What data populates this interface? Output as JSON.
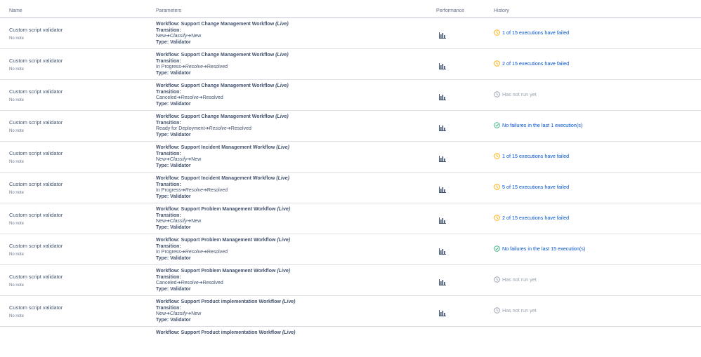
{
  "header": {
    "name": "Name",
    "parameters": "Parameters",
    "performance": "Performance",
    "history": "History"
  },
  "colors": {
    "warn": "#ffab00",
    "success": "#36b37e",
    "muted": "#97a0af",
    "link": "#0052cc"
  },
  "labels": {
    "transition": "Transition:",
    "live": "(Live)"
  },
  "rows": [
    {
      "name": "Custom script validator",
      "note": "No note",
      "workflow": "Workflow: Support Change Management Workflow",
      "from": "New",
      "action": "Classify",
      "to": "New",
      "type": "Type: Validator",
      "history": "1 of 15 executions have failed",
      "status": "warn"
    },
    {
      "name": "Custom script validator",
      "note": "No note",
      "workflow": "Workflow: Support Change Management Workflow",
      "from": "In Progress",
      "action": "Resolve",
      "to": "Resolved",
      "type": "Type: Validator",
      "history": "2 of 15 executions have failed",
      "status": "warn"
    },
    {
      "name": "Custom script validator",
      "note": "No note",
      "workflow": "Workflow: Support Change Management Workflow",
      "from": "Canceled",
      "action": "Resolve",
      "to": "Resolved",
      "type": "Type: Validator",
      "history": "Has not run yet",
      "status": "none"
    },
    {
      "name": "Custom script validator",
      "note": "No note",
      "workflow": "Workflow: Support Change Management Workflow",
      "from": "Ready for Deployment",
      "action": "Resolve",
      "to": "Resolved",
      "type": "Type: Validator",
      "history": "No failures in the last 1 execution(s)",
      "status": "ok"
    },
    {
      "name": "Custom script validator",
      "note": "No note",
      "workflow": "Workflow: Support Incident Management Workflow",
      "from": "New",
      "action": "Classify",
      "to": "New",
      "type": "Type: Validator",
      "history": "1 of 15 executions have failed",
      "status": "warn"
    },
    {
      "name": "Custom script validator",
      "note": "No note",
      "workflow": "Workflow: Support Incident Management Workflow",
      "from": "In Progress",
      "action": "Resolve",
      "to": "Resolved",
      "type": "Type: Validator",
      "history": "5 of 15 executions have failed",
      "status": "warn"
    },
    {
      "name": "Custom script validator",
      "note": "No note",
      "workflow": "Workflow: Support Problem Management Workflow",
      "from": "New",
      "action": "Classify",
      "to": "New",
      "type": "Type: Validator",
      "history": "2 of 15 executions have failed",
      "status": "warn"
    },
    {
      "name": "Custom script validator",
      "note": "No note",
      "workflow": "Workflow: Support Problem Management Workflow",
      "from": "In Progress",
      "action": "Resolve",
      "to": "Resolved",
      "type": "Type: Validator",
      "history": "No failures in the last 15 execution(s)",
      "status": "ok"
    },
    {
      "name": "Custom script validator",
      "note": "No note",
      "workflow": "Workflow: Support Problem Management Workflow",
      "from": "Canceled",
      "action": "Resolve",
      "to": "Resolved",
      "type": "Type: Validator",
      "history": "Has not run yet",
      "status": "none"
    },
    {
      "name": "Custom script validator",
      "note": "No note",
      "workflow": "Workflow: Support Product implementation Workflow",
      "from": "New",
      "action": "Classify",
      "to": "New",
      "type": "Type: Validator",
      "history": "Has not run yet",
      "status": "none"
    }
  ],
  "partial_row": {
    "workflow": "Workflow: Support Product implementation Workflow"
  }
}
